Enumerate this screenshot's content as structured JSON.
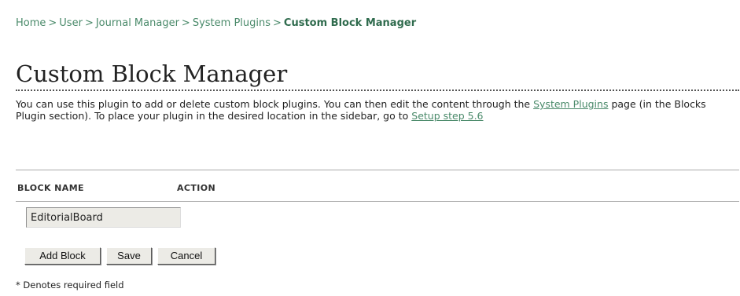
{
  "breadcrumb": {
    "items": [
      "Home",
      "User",
      "Journal Manager",
      "System Plugins"
    ],
    "separator": ">",
    "current": "Custom Block Manager"
  },
  "page_title": "Custom Block Manager",
  "intro": {
    "text_1": "You can use this plugin to add or delete custom block plugins. You can then edit the content through the ",
    "link_system_plugins": "System Plugins",
    "text_2": " page (in the Blocks Plugin section). To place your plugin in the desired location in the sidebar, go to ",
    "link_setup_step": "Setup step 5.6"
  },
  "table": {
    "columns": [
      "BLOCK NAME",
      "ACTION"
    ],
    "rows": [
      {
        "block_name_value": "EditorialBoard"
      }
    ]
  },
  "buttons": {
    "add_block": "Add Block",
    "save": "Save",
    "cancel": "Cancel"
  },
  "required_note": "* Denotes required field",
  "colors": {
    "link": "#4a8a6a",
    "current_crumb": "#2f6b4d",
    "button_face": "#ecebe6",
    "rule": "#aaaaaa"
  }
}
